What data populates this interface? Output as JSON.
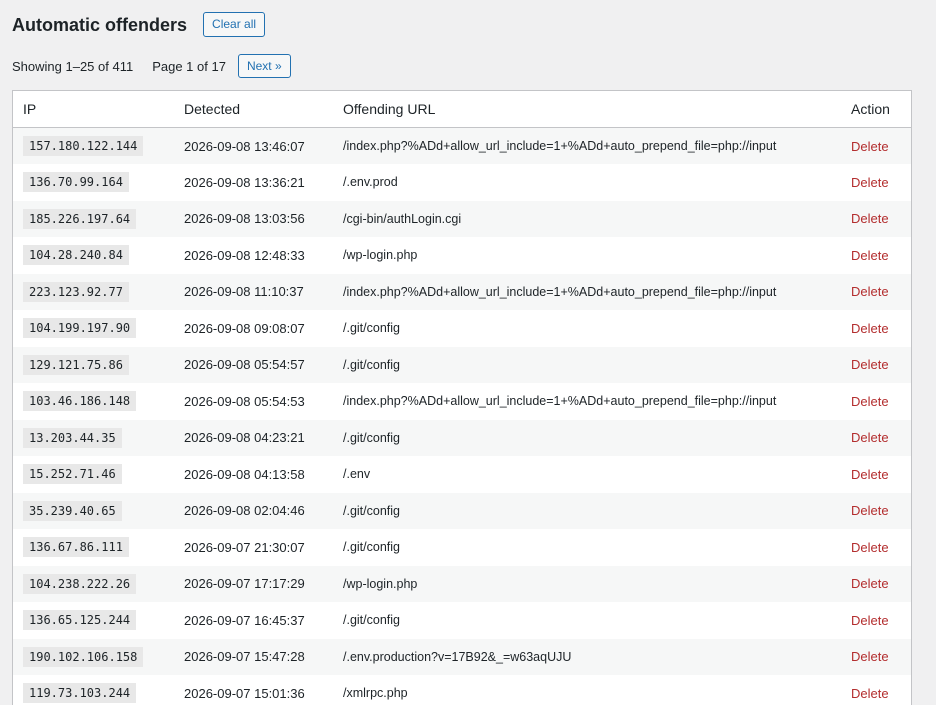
{
  "header": {
    "title": "Automatic offenders",
    "clear_label": "Clear all"
  },
  "pagination": {
    "showing": "Showing 1–25 of 411",
    "page": "Page 1 of 17",
    "next_label": "Next »"
  },
  "table": {
    "columns": {
      "ip": "IP",
      "detected": "Detected",
      "url": "Offending URL",
      "action": "Action"
    },
    "action_label": "Delete",
    "rows": [
      {
        "ip": "157.180.122.144",
        "detected": "2026-09-08 13:46:07",
        "url": "/index.php?%ADd+allow_url_include=1+%ADd+auto_prepend_file=php://input"
      },
      {
        "ip": "136.70.99.164",
        "detected": "2026-09-08 13:36:21",
        "url": "/.env.prod"
      },
      {
        "ip": "185.226.197.64",
        "detected": "2026-09-08 13:03:56",
        "url": "/cgi-bin/authLogin.cgi"
      },
      {
        "ip": "104.28.240.84",
        "detected": "2026-09-08 12:48:33",
        "url": "/wp-login.php"
      },
      {
        "ip": "223.123.92.77",
        "detected": "2026-09-08 11:10:37",
        "url": "/index.php?%ADd+allow_url_include=1+%ADd+auto_prepend_file=php://input"
      },
      {
        "ip": "104.199.197.90",
        "detected": "2026-09-08 09:08:07",
        "url": "/.git/config"
      },
      {
        "ip": "129.121.75.86",
        "detected": "2026-09-08 05:54:57",
        "url": "/.git/config"
      },
      {
        "ip": "103.46.186.148",
        "detected": "2026-09-08 05:54:53",
        "url": "/index.php?%ADd+allow_url_include=1+%ADd+auto_prepend_file=php://input"
      },
      {
        "ip": "13.203.44.35",
        "detected": "2026-09-08 04:23:21",
        "url": "/.git/config"
      },
      {
        "ip": "15.252.71.46",
        "detected": "2026-09-08 04:13:58",
        "url": "/.env"
      },
      {
        "ip": "35.239.40.65",
        "detected": "2026-09-08 02:04:46",
        "url": "/.git/config"
      },
      {
        "ip": "136.67.86.111",
        "detected": "2026-09-07 21:30:07",
        "url": "/.git/config"
      },
      {
        "ip": "104.238.222.26",
        "detected": "2026-09-07 17:17:29",
        "url": "/wp-login.php"
      },
      {
        "ip": "136.65.125.244",
        "detected": "2026-09-07 16:45:37",
        "url": "/.git/config"
      },
      {
        "ip": "190.102.106.158",
        "detected": "2026-09-07 15:47:28",
        "url": "/.env.production?v=17B92&_=w63aqUJU"
      },
      {
        "ip": "119.73.103.244",
        "detected": "2026-09-07 15:01:36",
        "url": "/xmlrpc.php"
      }
    ]
  },
  "colors": {
    "accent": "#2271b1",
    "danger": "#b32d2e",
    "background": "#f0f0f1"
  }
}
